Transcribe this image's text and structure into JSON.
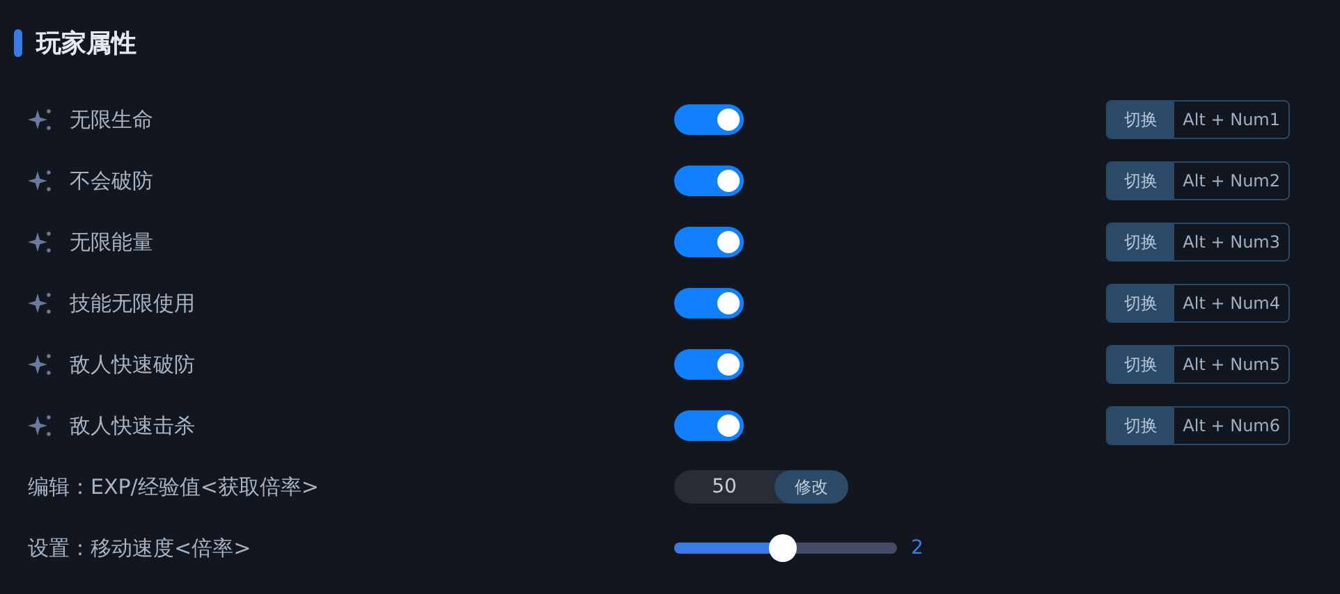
{
  "section": {
    "title": "玩家属性"
  },
  "cheats": [
    {
      "label": "无限生命",
      "on": true,
      "action": "切换",
      "hotkey": "Alt + Num1"
    },
    {
      "label": "不会破防",
      "on": true,
      "action": "切换",
      "hotkey": "Alt + Num2"
    },
    {
      "label": "无限能量",
      "on": true,
      "action": "切换",
      "hotkey": "Alt + Num3"
    },
    {
      "label": "技能无限使用",
      "on": true,
      "action": "切换",
      "hotkey": "Alt + Num4"
    },
    {
      "label": "敌人快速破防",
      "on": true,
      "action": "切换",
      "hotkey": "Alt + Num5"
    },
    {
      "label": "敌人快速击杀",
      "on": true,
      "action": "切换",
      "hotkey": "Alt + Num6"
    }
  ],
  "exp_row": {
    "label": "编辑：EXP/经验值<获取倍率>",
    "value": "50",
    "button": "修改"
  },
  "speed_row": {
    "label": "设置：移动速度<倍率>",
    "level": 0.49,
    "reading": "2"
  }
}
